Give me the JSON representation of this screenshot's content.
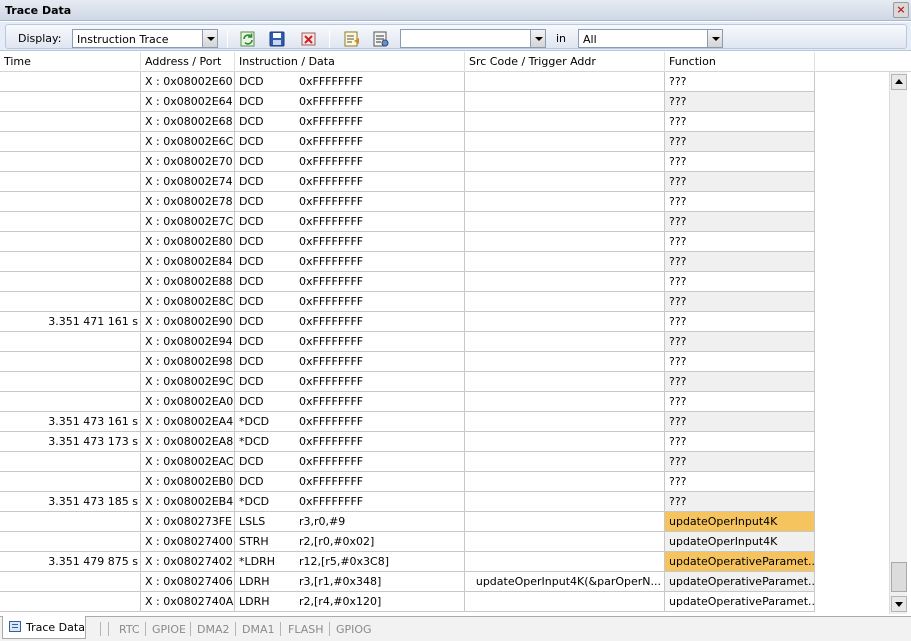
{
  "window": {
    "title": "Trace Data"
  },
  "toolbar": {
    "display_label": "Display:",
    "display_value": "Instruction Trace",
    "search_value": "",
    "in_label": "in",
    "scope_value": "All"
  },
  "columns": [
    "Time",
    "Address / Port",
    "Instruction / Data",
    "Src Code / Trigger Addr",
    "Function"
  ],
  "rows": [
    {
      "time": "",
      "addr": "X : 0x08002E60",
      "mn": "DCD",
      "op": "0xFFFFFFFF",
      "src": "",
      "func": "???",
      "hl": false
    },
    {
      "time": "",
      "addr": "X : 0x08002E64",
      "mn": "DCD",
      "op": "0xFFFFFFFF",
      "src": "",
      "func": "???",
      "hl": false
    },
    {
      "time": "",
      "addr": "X : 0x08002E68",
      "mn": "DCD",
      "op": "0xFFFFFFFF",
      "src": "",
      "func": "???",
      "hl": false
    },
    {
      "time": "",
      "addr": "X : 0x08002E6C",
      "mn": "DCD",
      "op": "0xFFFFFFFF",
      "src": "",
      "func": "???",
      "hl": false
    },
    {
      "time": "",
      "addr": "X : 0x08002E70",
      "mn": "DCD",
      "op": "0xFFFFFFFF",
      "src": "",
      "func": "???",
      "hl": false
    },
    {
      "time": "",
      "addr": "X : 0x08002E74",
      "mn": "DCD",
      "op": "0xFFFFFFFF",
      "src": "",
      "func": "???",
      "hl": false
    },
    {
      "time": "",
      "addr": "X : 0x08002E78",
      "mn": "DCD",
      "op": "0xFFFFFFFF",
      "src": "",
      "func": "???",
      "hl": false
    },
    {
      "time": "",
      "addr": "X : 0x08002E7C",
      "mn": "DCD",
      "op": "0xFFFFFFFF",
      "src": "",
      "func": "???",
      "hl": false
    },
    {
      "time": "",
      "addr": "X : 0x08002E80",
      "mn": "DCD",
      "op": "0xFFFFFFFF",
      "src": "",
      "func": "???",
      "hl": false
    },
    {
      "time": "",
      "addr": "X : 0x08002E84",
      "mn": "DCD",
      "op": "0xFFFFFFFF",
      "src": "",
      "func": "???",
      "hl": false
    },
    {
      "time": "",
      "addr": "X : 0x08002E88",
      "mn": "DCD",
      "op": "0xFFFFFFFF",
      "src": "",
      "func": "???",
      "hl": false
    },
    {
      "time": "",
      "addr": "X : 0x08002E8C",
      "mn": "DCD",
      "op": "0xFFFFFFFF",
      "src": "",
      "func": "???",
      "hl": false
    },
    {
      "time": "3.351 471 161 s",
      "addr": "X : 0x08002E90",
      "mn": "DCD",
      "op": "0xFFFFFFFF",
      "src": "",
      "func": "???",
      "hl": false
    },
    {
      "time": "",
      "addr": "X : 0x08002E94",
      "mn": "DCD",
      "op": "0xFFFFFFFF",
      "src": "",
      "func": "???",
      "hl": false
    },
    {
      "time": "",
      "addr": "X : 0x08002E98",
      "mn": "DCD",
      "op": "0xFFFFFFFF",
      "src": "",
      "func": "???",
      "hl": false
    },
    {
      "time": "",
      "addr": "X : 0x08002E9C",
      "mn": "DCD",
      "op": "0xFFFFFFFF",
      "src": "",
      "func": "???",
      "hl": false
    },
    {
      "time": "",
      "addr": "X : 0x08002EA0",
      "mn": "DCD",
      "op": "0xFFFFFFFF",
      "src": "",
      "func": "???",
      "hl": false
    },
    {
      "time": "3.351 473 161 s",
      "addr": "X : 0x08002EA4",
      "mn": "*DCD",
      "op": "0xFFFFFFFF",
      "src": "",
      "func": "???",
      "hl": false
    },
    {
      "time": "3.351 473 173 s",
      "addr": "X : 0x08002EA8",
      "mn": "*DCD",
      "op": "0xFFFFFFFF",
      "src": "",
      "func": "???",
      "hl": false
    },
    {
      "time": "",
      "addr": "X : 0x08002EAC",
      "mn": "DCD",
      "op": "0xFFFFFFFF",
      "src": "",
      "func": "???",
      "hl": false
    },
    {
      "time": "",
      "addr": "X : 0x08002EB0",
      "mn": "DCD",
      "op": "0xFFFFFFFF",
      "src": "",
      "func": "???",
      "hl": false
    },
    {
      "time": "3.351 473 185 s",
      "addr": "X : 0x08002EB4",
      "mn": "*DCD",
      "op": "0xFFFFFFFF",
      "src": "",
      "func": "???",
      "hl": false
    },
    {
      "time": "",
      "addr": "X : 0x080273FE",
      "mn": "LSLS",
      "op": "r3,r0,#9",
      "src": "",
      "func": "updateOperInput4K",
      "hl": true
    },
    {
      "time": "",
      "addr": "X : 0x08027400",
      "mn": "STRH",
      "op": "r2,[r0,#0x02]",
      "src": "",
      "func": "updateOperInput4K",
      "hl": false
    },
    {
      "time": "3.351 479 875 s",
      "addr": "X : 0x08027402",
      "mn": "*LDRH",
      "op": "r12,[r5,#0x3C8]",
      "src": "",
      "func": "updateOperativeParamet...",
      "hl": true
    },
    {
      "time": "",
      "addr": "X : 0x08027406",
      "mn": "LDRH",
      "op": "r3,[r1,#0x348]",
      "src": "updateOperInput4K(&parOperN...",
      "func": "updateOperativeParamet...",
      "hl": false
    },
    {
      "time": "",
      "addr": "X : 0x0802740A",
      "mn": "LDRH",
      "op": "r2,[r4,#0x120]",
      "src": "",
      "func": "updateOperativeParamet...",
      "hl": false
    }
  ],
  "bottom_tabs": {
    "active": "Trace Data",
    "others": [
      "RTC",
      "GPIOE",
      "DMA2",
      "DMA1",
      "FLASH",
      "GPIOG"
    ]
  },
  "colors": {
    "highlight": "#f6c45e",
    "accent": "#35609e"
  }
}
